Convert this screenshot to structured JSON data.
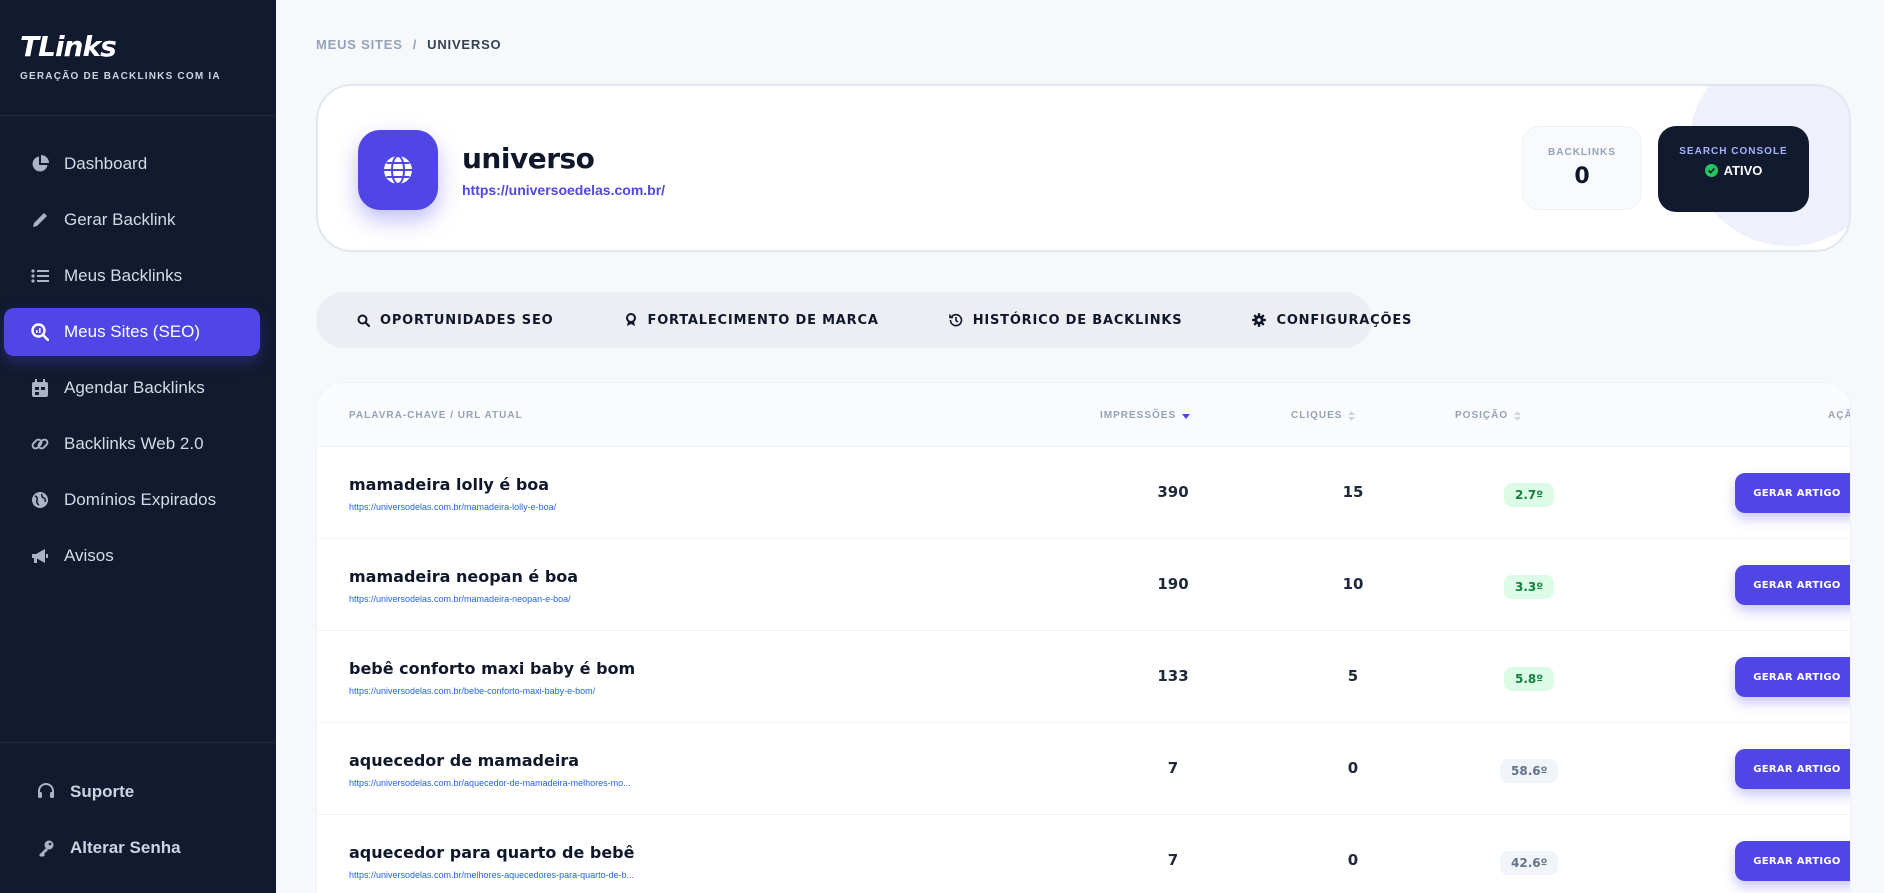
{
  "brand": {
    "logo": "TLinks",
    "tagline": "GERAÇÃO DE BACKLINKS COM IA"
  },
  "sidebar": {
    "items": [
      {
        "label": "Dashboard",
        "icon": "pie-chart-icon",
        "active": false
      },
      {
        "label": "Gerar Backlink",
        "icon": "pencil-icon",
        "active": false
      },
      {
        "label": "Meus Backlinks",
        "icon": "list-icon",
        "active": false
      },
      {
        "label": "Meus Sites (SEO)",
        "icon": "search-chart-icon",
        "active": true
      },
      {
        "label": "Agendar Backlinks",
        "icon": "calendar-icon",
        "active": false
      },
      {
        "label": "Backlinks Web 2.0",
        "icon": "link-icon",
        "active": false
      },
      {
        "label": "Domínios Expirados",
        "icon": "globe-icon",
        "active": false
      },
      {
        "label": "Avisos",
        "icon": "megaphone-icon",
        "active": false
      }
    ],
    "bottom": [
      {
        "label": "Suporte",
        "icon": "headset-icon"
      },
      {
        "label": "Alterar Senha",
        "icon": "key-icon"
      }
    ]
  },
  "breadcrumb": {
    "parent": "MEUS SITES",
    "separator": "/",
    "current": "UNIVERSO"
  },
  "site": {
    "name": "universo",
    "url": "https://universoedelas.com.br/",
    "backlinks_label": "BACKLINKS",
    "backlinks_value": "0",
    "search_console_label": "SEARCH CONSOLE",
    "search_console_status": "ATIVO"
  },
  "tabs": [
    {
      "label": "OPORTUNIDADES SEO",
      "icon": "search-icon"
    },
    {
      "label": "FORTALECIMENTO DE MARCA",
      "icon": "award-icon"
    },
    {
      "label": "HISTÓRICO DE BACKLINKS",
      "icon": "history-icon"
    },
    {
      "label": "CONFIGURAÇÕES",
      "icon": "gear-icon"
    }
  ],
  "table": {
    "headers": {
      "keyword": "PALAVRA-CHAVE / URL ATUAL",
      "impressions": "IMPRESSÕES",
      "clicks": "CLIQUES",
      "position": "POSIÇÃO",
      "action": "AÇÃO"
    },
    "rows": [
      {
        "keyword": "mamadeira lolly é boa",
        "url": "https://universodelas.com.br/mamadeira-lolly-e-boa/",
        "impressions": "390",
        "clicks": "15",
        "position": "2.7º",
        "position_status": "good",
        "action": "GERAR ARTIGO"
      },
      {
        "keyword": "mamadeira neopan é boa",
        "url": "https://universodelas.com.br/mamadeira-neopan-e-boa/",
        "impressions": "190",
        "clicks": "10",
        "position": "3.3º",
        "position_status": "good",
        "action": "GERAR ARTIGO"
      },
      {
        "keyword": "bebê conforto maxi baby é bom",
        "url": "https://universodelas.com.br/bebe-conforto-maxi-baby-e-bom/",
        "impressions": "133",
        "clicks": "5",
        "position": "5.8º",
        "position_status": "good",
        "action": "GERAR ARTIGO"
      },
      {
        "keyword": "aquecedor de mamadeira",
        "url": "https://universodelas.com.br/aquecedor-de-mamadeira-melhores-mo...",
        "impressions": "7",
        "clicks": "0",
        "position": "58.6º",
        "position_status": "neutral",
        "action": "GERAR ARTIGO"
      },
      {
        "keyword": "aquecedor para quarto de bebê",
        "url": "https://universodelas.com.br/melhores-aquecedores-para-quarto-de-b...",
        "impressions": "7",
        "clicks": "0",
        "position": "42.6º",
        "position_status": "neutral",
        "action": "GERAR ARTIGO"
      }
    ]
  },
  "colors": {
    "accent": "#4f46e5",
    "sidebar_bg": "#111a2e",
    "good": "#15803d",
    "good_bg": "#dcfce7"
  }
}
